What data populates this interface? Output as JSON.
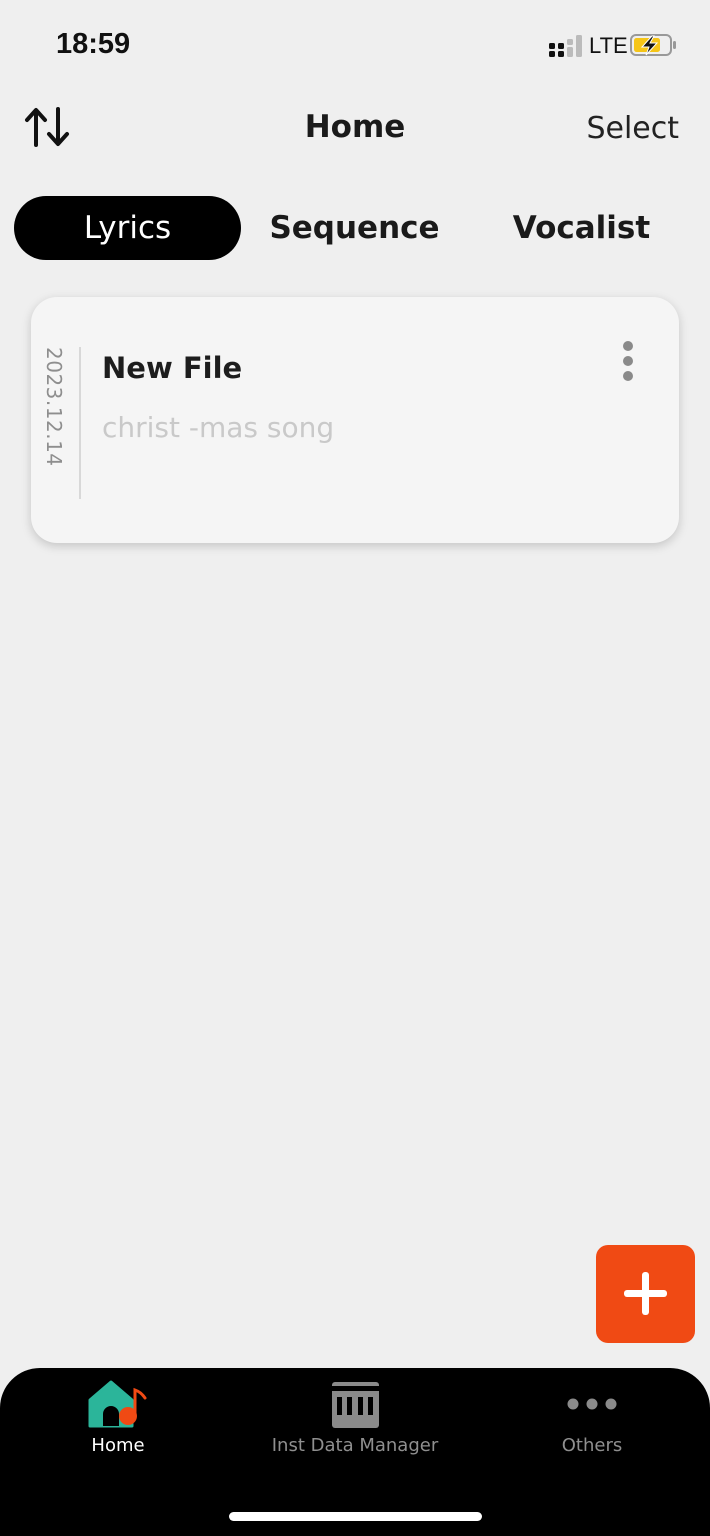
{
  "status_bar": {
    "time": "18:59",
    "network": "LTE",
    "battery_color": "#f5c518"
  },
  "header": {
    "title": "Home",
    "select_label": "Select",
    "sort_icon": "sort-arrows-icon"
  },
  "tabs": [
    {
      "label": "Lyrics",
      "active": true
    },
    {
      "label": "Sequence",
      "active": false
    },
    {
      "label": "Vocalist",
      "active": false
    }
  ],
  "files": [
    {
      "date": "2023.12.14",
      "title": "New File",
      "subtitle": "christ -mas song"
    }
  ],
  "fab": {
    "icon": "plus-icon",
    "color": "#f04a14"
  },
  "bottom_nav": [
    {
      "label": "Home",
      "icon": "home-music-icon",
      "active": true
    },
    {
      "label": "Inst Data Manager",
      "icon": "piano-keys-icon",
      "active": false
    },
    {
      "label": "Others",
      "icon": "more-dots-icon",
      "active": false
    }
  ],
  "colors": {
    "accent": "#f04a14",
    "home_teal": "#2bb59a",
    "background": "#efefef"
  }
}
